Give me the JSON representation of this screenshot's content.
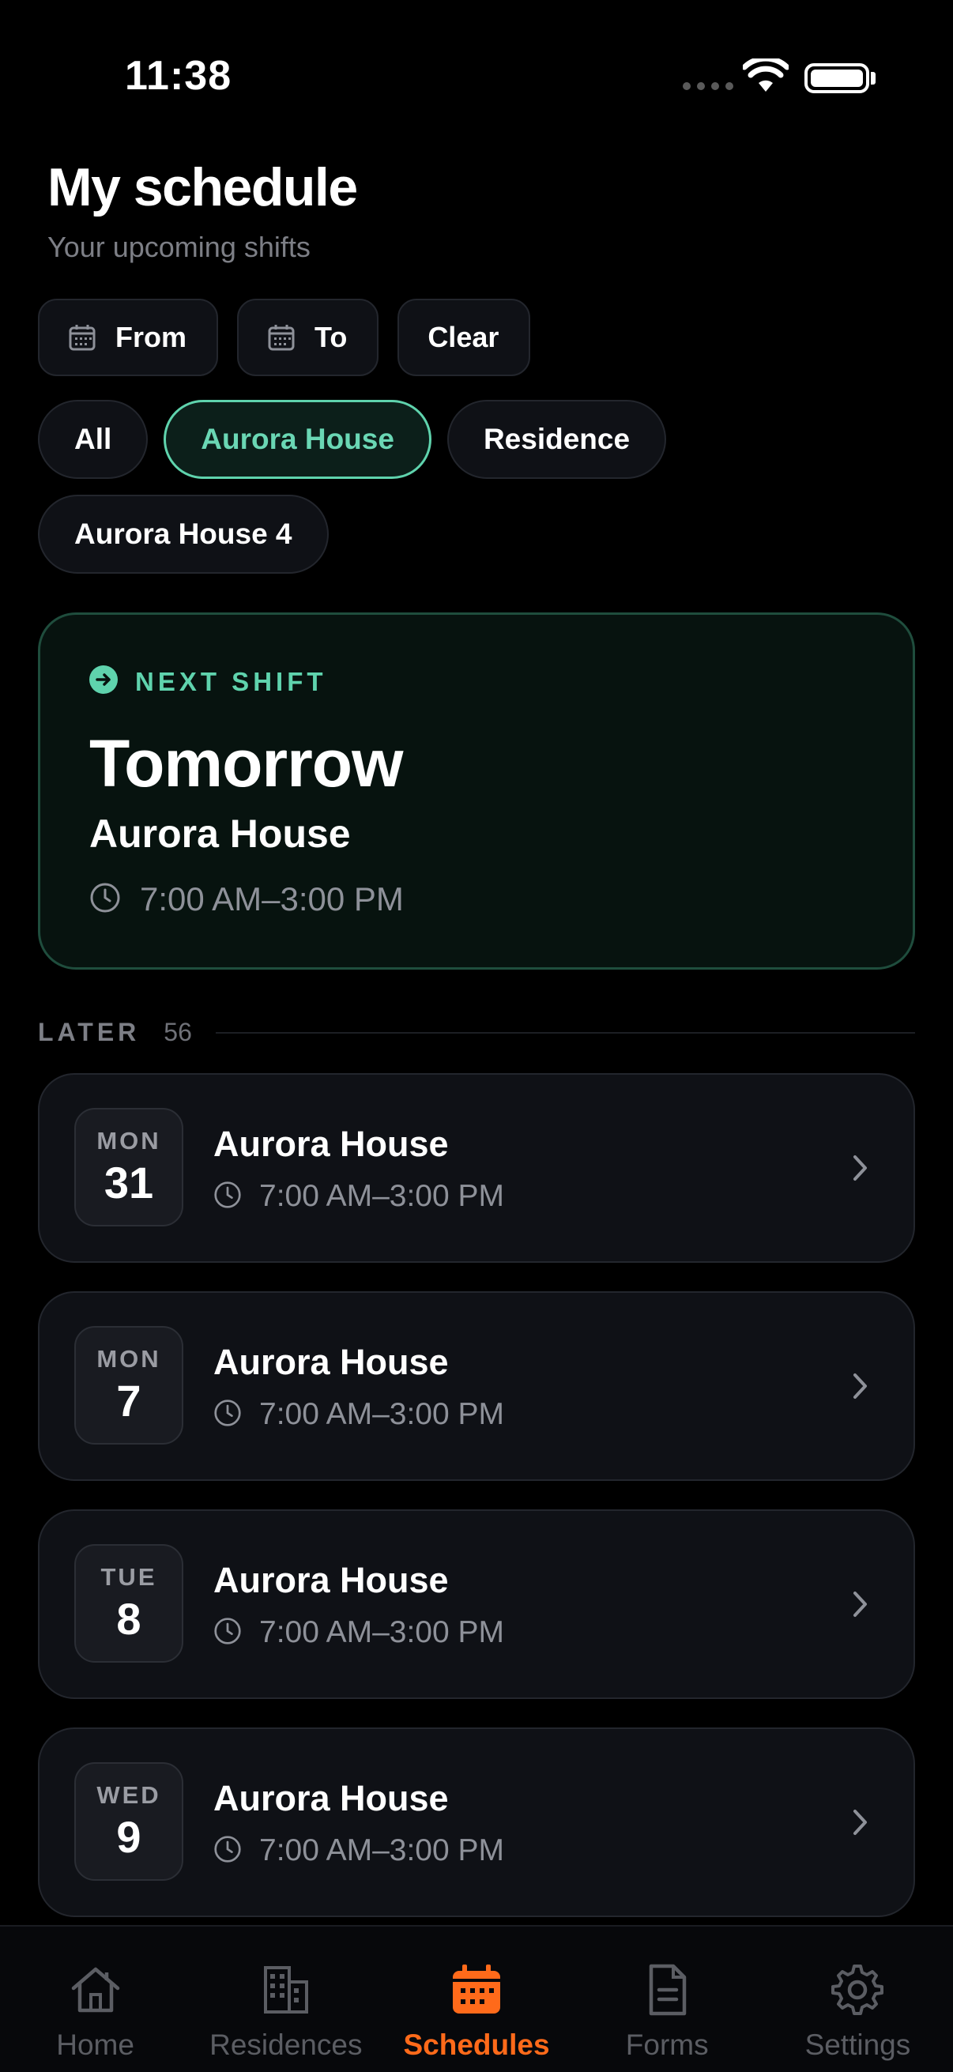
{
  "status_bar": {
    "time": "11:38",
    "icons": [
      "signal-icon",
      "wifi-icon",
      "battery-icon"
    ]
  },
  "header": {
    "title": "My schedule",
    "subtitle": "Your upcoming shifts"
  },
  "date_filters": {
    "from_label": "From",
    "to_label": "To",
    "clear_label": "Clear"
  },
  "residence_filters": {
    "options": [
      "All",
      "Aurora House",
      "Residence",
      "Aurora House 4"
    ],
    "selected": "Aurora House"
  },
  "next_shift": {
    "label": "NEXT SHIFT",
    "day": "Tomorrow",
    "residence": "Aurora House",
    "time": "7:00 AM–3:00 PM"
  },
  "later": {
    "label": "LATER",
    "count": "56",
    "shifts": [
      {
        "dow": "MON",
        "day": "31",
        "residence": "Aurora House",
        "time": "7:00 AM–3:00 PM"
      },
      {
        "dow": "MON",
        "day": "7",
        "residence": "Aurora House",
        "time": "7:00 AM–3:00 PM"
      },
      {
        "dow": "TUE",
        "day": "8",
        "residence": "Aurora House",
        "time": "7:00 AM–3:00 PM"
      },
      {
        "dow": "WED",
        "day": "9",
        "residence": "Aurora House",
        "time": "7:00 AM–3:00 PM"
      }
    ]
  },
  "tab_bar": {
    "tabs": [
      {
        "label": "Home",
        "icon": "home-icon"
      },
      {
        "label": "Residences",
        "icon": "building-icon"
      },
      {
        "label": "Schedules",
        "icon": "calendar-icon"
      },
      {
        "label": "Forms",
        "icon": "document-icon"
      },
      {
        "label": "Settings",
        "icon": "gear-icon"
      }
    ],
    "active": "Schedules"
  },
  "colors": {
    "accent_green": "#5fd3ad",
    "accent_orange": "#ff6a1a",
    "background": "#000000",
    "card": "#0f1116"
  }
}
